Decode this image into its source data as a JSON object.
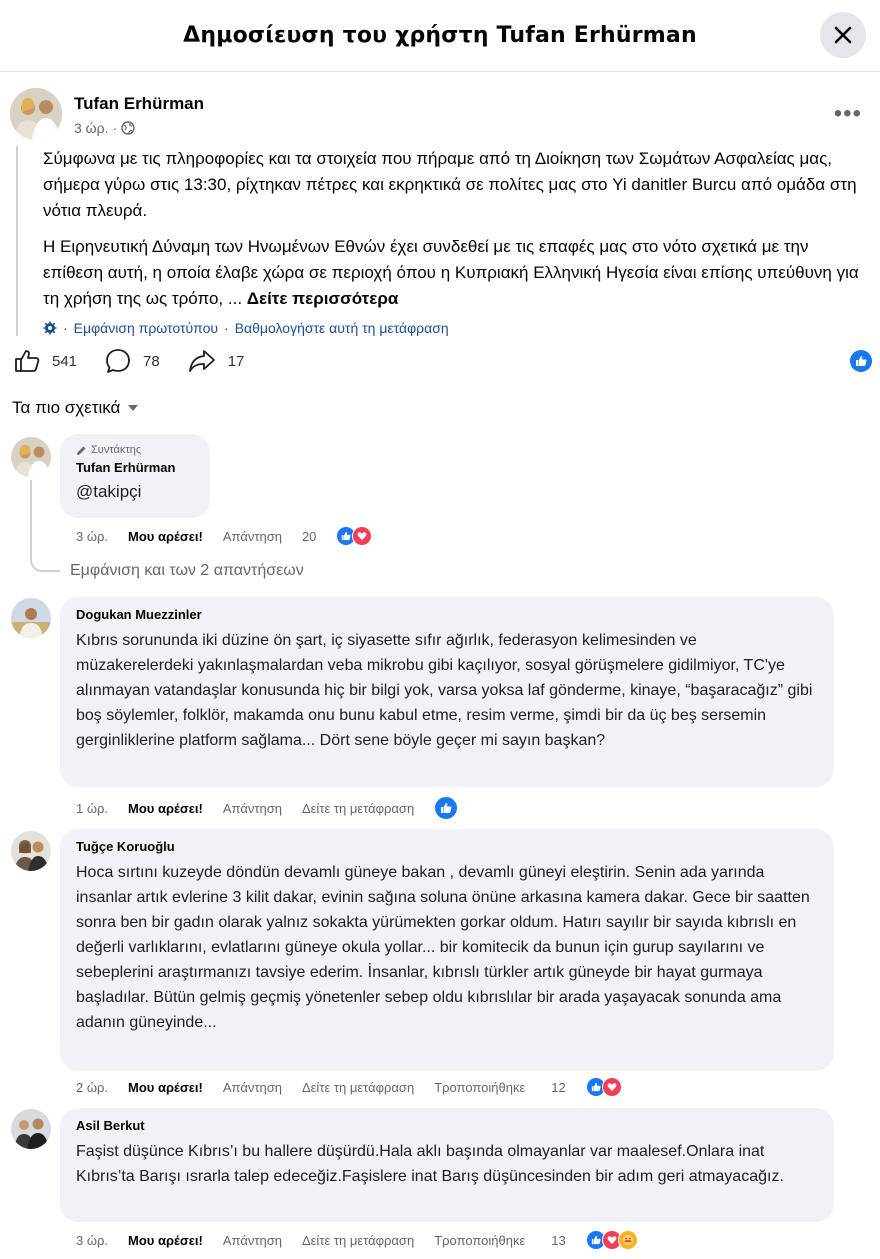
{
  "header": {
    "title": "Δημοσίευση του χρήστη Tufan Erhürman"
  },
  "post": {
    "author": "Tufan Erhürman",
    "time": "3 ώρ.",
    "separator": "·",
    "paragraph1": "Σύμφωνα με τις πληροφορίες και τα στοιχεία που πήραμε από τη Διοίκηση των Σωμάτων Ασφαλείας μας, σήμερα γύρω στις 13:30, ρίχτηκαν πέτρες και εκρηκτικά σε πολίτες μας στο Yi danitler Burcu από ομάδα στη νότια πλευρά.",
    "paragraph2": "Η Ειρηνευτική Δύναμη των Ηνωμένων Εθνών έχει συνδεθεί με τις επαφές μας στο νότο σχετικά με την επίθεση αυτή, η οποία έλαβε χώρα σε περιοχή όπου η Κυπριακή Ελληνική Ηγεσία είναι επίσης υπεύθυνη για τη χρήση της ως τρόπο, ...",
    "see_more": "Δείτε περισσότερα",
    "show_original": "Εμφάνιση πρωτοτύπου",
    "rate_translation": "Βαθμολογήστε αυτή τη μετάφραση",
    "likes": "541",
    "comments": "78",
    "shares": "17"
  },
  "sort_label": "Τα πιο σχετικά",
  "comments": [
    {
      "author_badge": "Συντάκτης",
      "author": "Tufan Erhürman",
      "text": "@takipçi",
      "time": "3 ώρ.",
      "like": "Μου αρέσει!",
      "reply": "Απάντηση",
      "reactions": "20",
      "replies_link": "Εμφάνιση και των 2 απαντήσεων"
    },
    {
      "author": "Dogukan Muezzinler",
      "text": "Kıbrıs sorununda iki düzine ön şart, iç siyasette sıfır ağırlık, federasyon kelimesinden ve müzakerelerdeki yakınlaşmalardan veba mikrobu gibi kaçılıyor, sosyal görüşmelere gidilmiyor, TC'ye alınmayan vatandaşlar konusunda hiç bir bilgi yok, varsa yoksa laf gönderme, kinaye, “başaracağız” gibi boş söylemler, folklör, makamda onu bunu kabul etme, resim verme, şimdi bir da üç beş sersemin gerginliklerine platform sağlama... Dört sene böyle geçer mi sayın başkan?",
      "time": "1 ώρ.",
      "like": "Μου αρέσει!",
      "reply": "Απάντηση",
      "translate": "Δείτε τη μετάφραση"
    },
    {
      "author": "Tuğçe Koruoğlu",
      "text": "Hoca sırtını kuzeyde döndün devamlı güneye bakan , devamlı güneyi eleştirin. Senin ada yarında insanlar artık evlerine 3 kilit dakar, evinin sağına soluna önüne arkasına kamera dakar. Gece bir saatten sonra ben bir gadın olarak yalnız sokakta yürümekten gorkar oldum. Hatırı sayılır bir sayıda kıbrıslı en değerli varlıklarını, evlatlarını güneye okula yollar... bir komitecik da bunun için gurup sayılarını ve sebeplerini araştırmanızı tavsiye ederim. İnsanlar, kıbrıslı türkler artık güneyde bir hayat gurmaya başladılar. Bütün gelmiş geçmiş yönetenler sebep oldu kıbrıslılar bir arada yaşayacak sonunda ama adanın güneyinde...",
      "time": "2 ώρ.",
      "like": "Μου αρέσει!",
      "reply": "Απάντηση",
      "translate": "Δείτε τη μετάφραση",
      "edited": "Τροποποιήθηκε",
      "reactions": "12"
    },
    {
      "author": "Asil Berkut",
      "text": "Faşist düşünce Kıbrıs’ı bu hallere düşürdü.Hala aklı başında olmayanlar var maalesef.Onlara inat Kıbrıs’ta Barışı ısrarla talep edeceğiz.Faşislere inat Barış düşüncesinden bir adım geri atmayacağız.",
      "time": "3 ώρ.",
      "like": "Μου αρέσει!",
      "reply": "Απάντηση",
      "translate": "Δείτε τη μετάφραση",
      "edited": "Τροποποιήθηκε",
      "reactions": "13"
    }
  ],
  "colors": {
    "accent": "#1877f2",
    "bubble": "#f0f2f5",
    "muted": "#65676b",
    "link": "#1c4e94"
  }
}
